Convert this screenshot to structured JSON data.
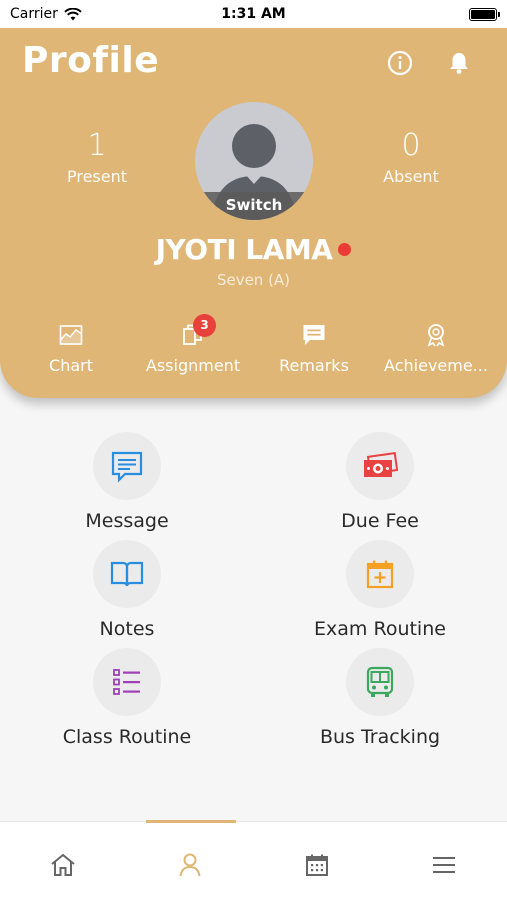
{
  "status_bar": {
    "carrier": "Carrier",
    "time": "1:31 AM"
  },
  "header": {
    "title": "Profile",
    "present": {
      "count": "1",
      "label": "Present"
    },
    "absent": {
      "count": "0",
      "label": "Absent"
    },
    "switch_label": "Switch",
    "student_name": "JYOTI LAMA",
    "student_class": "Seven (A)",
    "online_status_color": "#ea3b36"
  },
  "quick_tabs": [
    {
      "label": "Chart",
      "icon": "chart-icon"
    },
    {
      "label": "Assignment",
      "icon": "assignment-icon",
      "badge": "3"
    },
    {
      "label": "Remarks",
      "icon": "remarks-icon"
    },
    {
      "label": "Achieveme...",
      "icon": "award-icon"
    }
  ],
  "menu": [
    {
      "label": "Message",
      "icon": "message-icon",
      "color": "#2a8ee0"
    },
    {
      "label": "Due Fee",
      "icon": "money-icon",
      "color": "#e84242"
    },
    {
      "label": "Notes",
      "icon": "book-icon",
      "color": "#2a8ee0"
    },
    {
      "label": "Exam Routine",
      "icon": "calendar-plus-icon",
      "color": "#f4a024"
    },
    {
      "label": "Class Routine",
      "icon": "list-icon",
      "color": "#a03fb8"
    },
    {
      "label": "Bus Tracking",
      "icon": "bus-icon",
      "color": "#3aa95e"
    }
  ],
  "bottom_nav": {
    "items": [
      "home-icon",
      "profile-icon",
      "calendar-icon",
      "menu-icon"
    ],
    "active": "profile-icon",
    "active_color": "#dfb676"
  },
  "colors": {
    "header": "#dfb676"
  }
}
